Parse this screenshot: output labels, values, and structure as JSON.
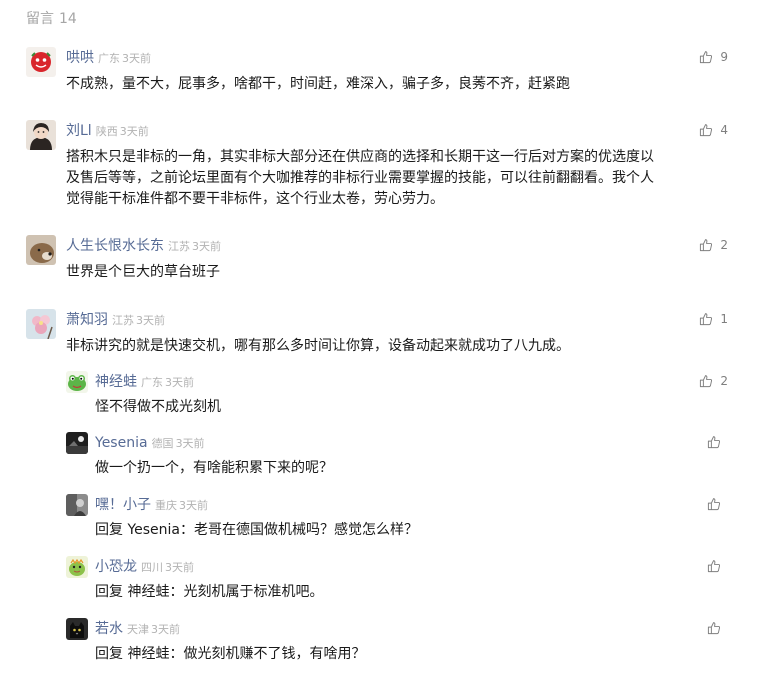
{
  "header": {
    "title": "留言",
    "count": "14"
  },
  "comments": [
    {
      "name": "哄哄",
      "loc": "广东",
      "time": "3天前",
      "likes": "9",
      "text": "不成熟，量不大，屁事多，啥都干，时间赶，难深入，骗子多，良莠不齐，赶紧跑"
    },
    {
      "name": "刘Ll",
      "loc": "陕西",
      "time": "3天前",
      "likes": "4",
      "text_lines": [
        "搭积木只是非标的一角，其实非标大部分还在供应商的选择和长期干这一行后对方案的优选度以",
        "及售后等等，之前论坛里面有个大咖推荐的非标行业需要掌握的技能，可以往前翻翻看。我个人",
        "觉得能干标准件都不要干非标件，这个行业太卷，劳心劳力。"
      ]
    },
    {
      "name": "人生长恨水长东",
      "loc": "江苏",
      "time": "3天前",
      "likes": "2",
      "text": "世界是个巨大的草台班子"
    },
    {
      "name": "萧知羽",
      "loc": "江苏",
      "time": "3天前",
      "likes": "1",
      "text": "非标讲究的就是快速交机，哪有那么多时间让你算，设备动起来就成功了八九成。"
    }
  ],
  "replies": [
    {
      "name": "神经蛙",
      "loc": "广东",
      "time": "3天前",
      "likes": "2",
      "text": "怪不得做不成光刻机"
    },
    {
      "name": "Yesenia",
      "loc": "德国",
      "time": "3天前",
      "likes": "",
      "text": "做一个扔一个，有啥能积累下来的呢？"
    },
    {
      "name": "嘿！小子",
      "loc": "重庆",
      "time": "3天前",
      "likes": "",
      "text": "回复 Yesenia：老哥在德国做机械吗？感觉怎么样？"
    },
    {
      "name": "小恐龙",
      "loc": "四川",
      "time": "3天前",
      "likes": "",
      "text": "回复 神经蛙：光刻机属于标准机吧。"
    },
    {
      "name": "若水",
      "loc": "天津",
      "time": "3天前",
      "likes": "",
      "text": "回复 神经蛙：做光刻机赚不了钱，有啥用？"
    }
  ],
  "colors": {
    "name": "#576b95",
    "meta": "#b2b2b2",
    "text": "#1a1a1a",
    "like": "#7f7f7f"
  },
  "icons": {
    "like": "thumbs-up-icon"
  }
}
